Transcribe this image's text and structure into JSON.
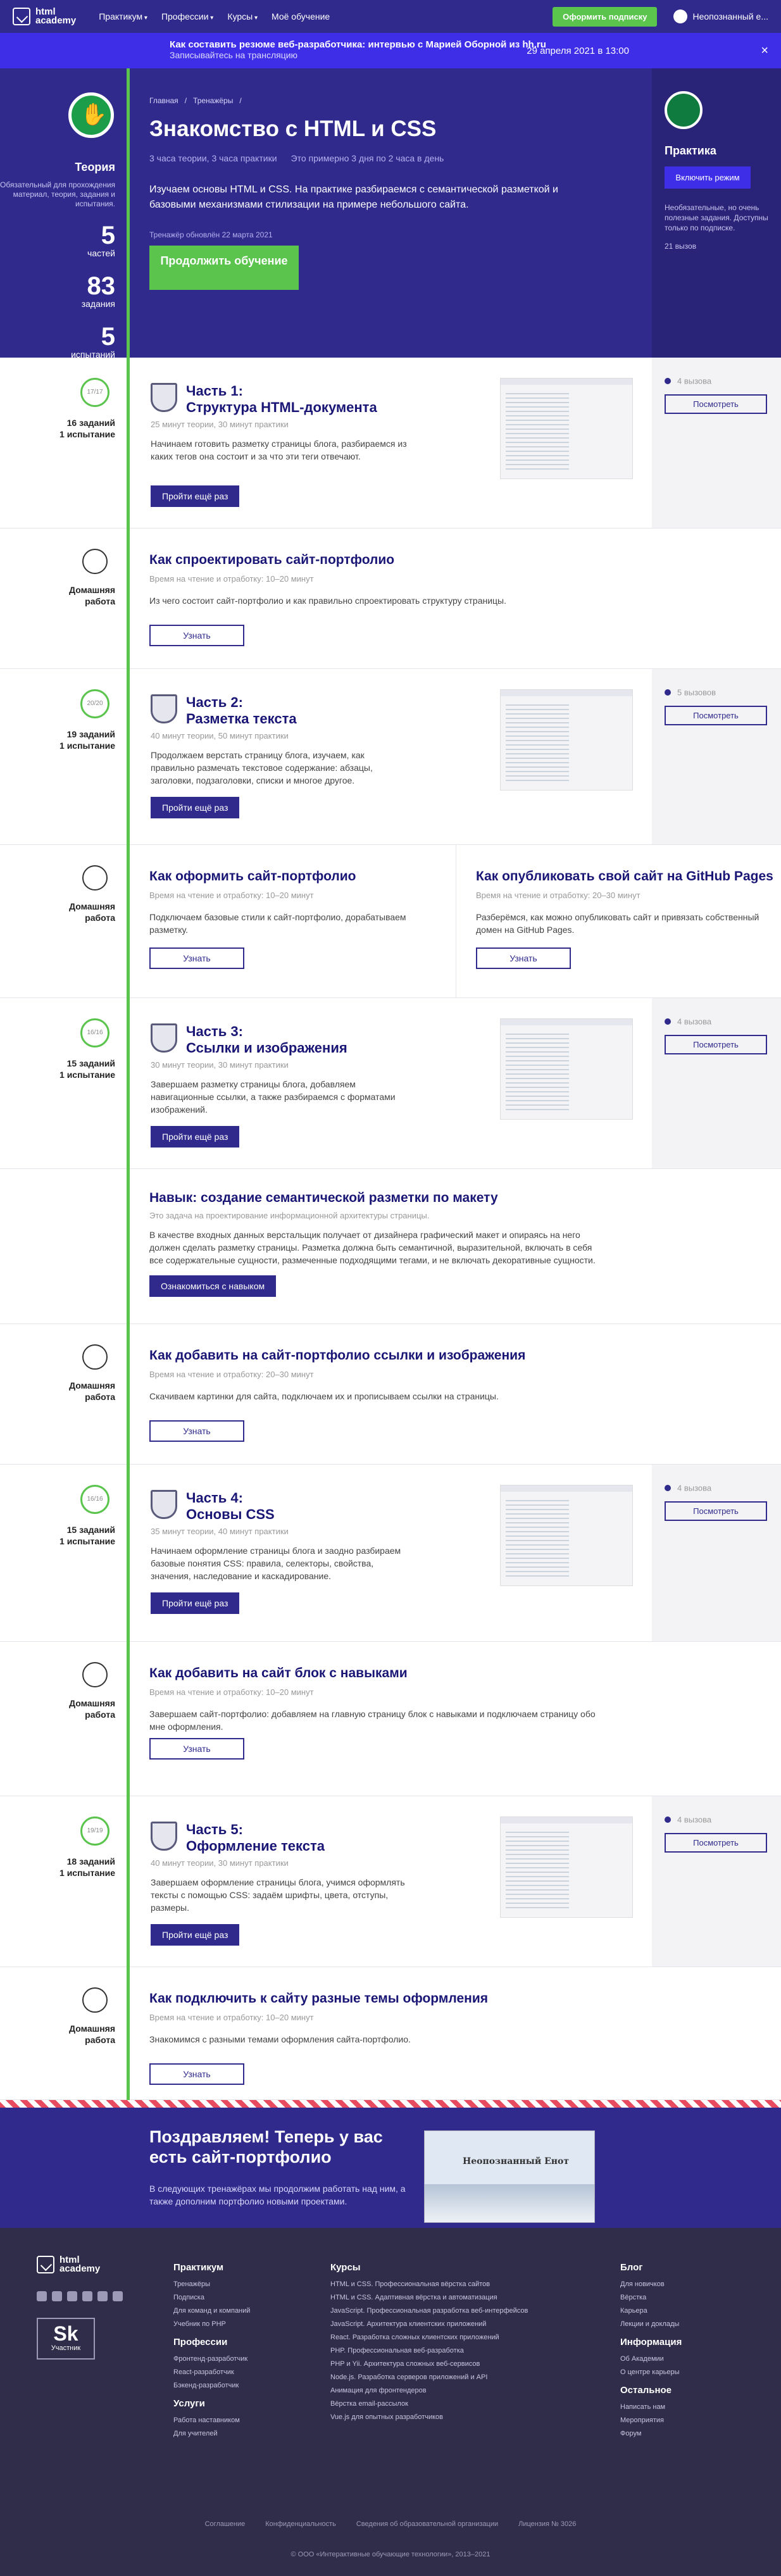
{
  "topbar": {
    "logo_line1": "html",
    "logo_line2": "academy",
    "nav": [
      "Практикум",
      "Профессии",
      "Курсы",
      "Моё обучение"
    ],
    "subscribe": "Оформить подписку",
    "user": "Неопознанный е..."
  },
  "banner": {
    "title": "Как составить резюме веб-разработчика: интервью с Марией Оборной из hh.ru",
    "subtitle": "Записывайтесь на трансляцию",
    "date": "29 апреля 2021 в 13:00",
    "close": "×"
  },
  "hero": {
    "left_title": "Теория",
    "left_desc": "Обязательный для прохождения материал, теория, задания и испытания.",
    "stats": [
      {
        "num": "5",
        "label": "частей"
      },
      {
        "num": "83",
        "label": "задания"
      },
      {
        "num": "5",
        "label": "испытаний"
      }
    ],
    "crumbs": [
      "Главная",
      "/",
      "Тренажёры",
      "/"
    ],
    "title": "Знакомство с HTML и CSS",
    "meta": [
      "3 часа теории, 3 часа практики",
      "Это примерно 3 дня по 2 часа в день"
    ],
    "intro": "Изучаем основы HTML и CSS. На практике разбираемся с семантической разметкой и базовыми механизмами стилизации на примере небольшого сайта.",
    "updated": "Тренажёр обновлён 22 марта 2021",
    "continue": "Продолжить обучение",
    "right_title": "Практика",
    "right_btn": "Включить режим",
    "right_desc": "Необязательные, но очень полезные задания. Доступны только по подписке.",
    "right_count": "21 вызов"
  },
  "parts": [
    {
      "label": "16 заданий\n1 испытание",
      "circle": "17/17",
      "title": "Часть 1:\nСтруктура HTML-документа",
      "sub": "25 минут теории, 30 минут практики",
      "desc": "Начинаем готовить разметку страницы блога, разбираемся из каких тегов она состоит и за что эти теги отвечают.",
      "btn": "Пройти ещё раз",
      "calls": "4 вызова",
      "view": "Посмотреть"
    },
    {
      "label": "19 заданий\n1 испытание",
      "circle": "20/20",
      "title": "Часть 2:\nРазметка текста",
      "sub": "40 минут теории, 50 минут практики",
      "desc": "Продолжаем верстать страницу блога, изучаем, как правильно размечать текстовое содержание: абзацы, заголовки, подзаголовки, списки и многое другое.",
      "btn": "Пройти ещё раз",
      "calls": "5 вызовов",
      "view": "Посмотреть"
    },
    {
      "label": "15 заданий\n1 испытание",
      "circle": "16/16",
      "title": "Часть 3:\nСсылки и изображения",
      "sub": "30 минут теории, 30 минут практики",
      "desc": "Завершаем разметку страницы блога, добавляем навигационные ссылки, а также разбираемся с форматами изображений.",
      "btn": "Пройти ещё раз",
      "calls": "4 вызова",
      "view": "Посмотреть"
    },
    {
      "label": "15 заданий\n1 испытание",
      "circle": "16/16",
      "title": "Часть 4:\nОсновы CSS",
      "sub": "35 минут теории, 40 минут практики",
      "desc": "Начинаем оформление страницы блога и заодно разбираем базовые понятия CSS: правила, селекторы, свойства, значения, наследование и каскадирование.",
      "btn": "Пройти ещё раз",
      "calls": "4 вызова",
      "view": "Посмотреть"
    },
    {
      "label": "18 заданий\n1 испытание",
      "circle": "19/19",
      "title": "Часть 5:\nОформление текста",
      "sub": "40 минут теории, 30 минут практики",
      "desc": "Завершаем оформление страницы блога, учимся оформлять тексты с помощью CSS: задаём шрифты, цвета, отступы, размеры.",
      "btn": "Пройти ещё раз",
      "calls": "4 вызова",
      "view": "Посмотреть"
    }
  ],
  "hw_label": "Домашняя\nработа",
  "homeworks": [
    {
      "title": "Как спроектировать сайт-портфолио",
      "sub": "Время на чтение и отработку: 10–20 минут",
      "desc": "Из чего состоит сайт-портфолио и как правильно спроектировать структуру страницы.",
      "btn": "Узнать"
    },
    {
      "title": "Как оформить сайт-портфолио",
      "sub": "Время на чтение и отработку: 10–20 минут",
      "desc": "Подключаем базовые стили к сайт-портфолио, дорабатываем разметку.",
      "btn": "Узнать"
    },
    {
      "title": "Как опубликовать свой сайт на GitHub Pages",
      "sub": "Время на чтение и отработку: 20–30 минут",
      "desc": "Разберёмся, как можно опубликовать сайт и привязать собственный домен на GitHub Pages.",
      "btn": "Узнать"
    },
    {
      "title": "Как добавить на сайт-портфолио ссылки и изображения",
      "sub": "Время на чтение и отработку: 20–30 минут",
      "desc": "Скачиваем картинки для сайта, подключаем их и прописываем ссылки на страницы.",
      "btn": "Узнать"
    },
    {
      "title": "Как добавить на сайт блок с навыками",
      "sub": "Время на чтение и отработку: 10–20 минут",
      "desc": "Завершаем сайт-портфолио: добавляем на главную страницу блок с навыками и подключаем страницу обо мне оформления.",
      "btn": "Узнать"
    },
    {
      "title": "Как подключить к сайту разные темы оформления",
      "sub": "Время на чтение и отработку: 10–20 минут",
      "desc": "Знакомимся с разными темами оформления сайта-портфолио.",
      "btn": "Узнать"
    }
  ],
  "skill": {
    "title": "Навык: создание семантической разметки по макету",
    "sub": "Это задача на проектирование информационной архитектуры страницы.",
    "desc": "В качестве входных данных верстальщик получает от дизайнера графический макет и опираясь на него должен сделать разметку страницы. Разметка должна быть семантичной, выразительной, включать в себя все содержательные сущности, размеченные подходящими тегами, и не включать декоративные сущности.",
    "btn": "Ознакомиться с навыком"
  },
  "congrats": {
    "title": "Поздравляем! Теперь у вас есть сайт-портфолио",
    "desc": "В следующих тренажёрах мы продолжим работать над ним, а также дополним портфолио новыми проектами.",
    "img_text": "Неопознанный Енот"
  },
  "footer": {
    "practicum": {
      "h": "Практикум",
      "items": [
        "Тренажёры",
        "Подписка",
        "Для команд и компаний",
        "Учебник по PHP"
      ]
    },
    "professions": {
      "h": "Профессии",
      "items": [
        "Фронтенд-разработчик",
        "React-разработчик",
        "Бэкенд-разработчик"
      ]
    },
    "services": {
      "h": "Услуги",
      "items": [
        "Работа наставником",
        "Для учителей"
      ]
    },
    "courses": {
      "h": "Курсы",
      "items": [
        "HTML и CSS. Профессиональная вёрстка сайтов",
        "HTML и CSS. Адаптивная вёрстка и автоматизация",
        "JavaScript. Профессиональная разработка веб-интерфейсов",
        "JavaScript. Архитектура клиентских приложений",
        "React. Разработка сложных клиентских приложений",
        "PHP. Профессиональная веб-разработка",
        "PHP и Yii. Архитектура сложных веб-сервисов",
        "Node.js. Разработка серверов приложений и API",
        "Анимация для фронтендеров",
        "Вёрстка email-рассылок",
        "Vue.js для опытных разработчиков"
      ]
    },
    "blog": {
      "h": "Блог",
      "items": [
        "Для новичков",
        "Вёрстка",
        "Карьера",
        "Лекции и доклады"
      ]
    },
    "info": {
      "h": "Информация",
      "items": [
        "Об Академии",
        "О центре карьеры"
      ]
    },
    "other": {
      "h": "Остальное",
      "items": [
        "Написать нам",
        "Мероприятия",
        "Форум"
      ]
    },
    "sk": "Sk",
    "sk_sub": "Участник",
    "bottom": [
      "Соглашение",
      "Конфиденциальность",
      "Сведения об образовательной организации",
      "Лицензия № 3026"
    ],
    "copy": "© ООО «Интерактивные обучающие технологии», 2013–2021"
  }
}
